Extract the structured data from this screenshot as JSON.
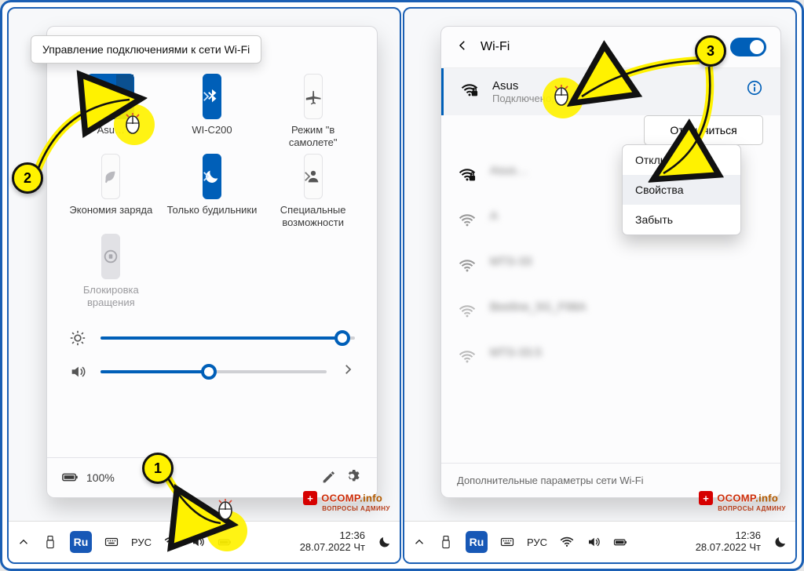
{
  "tooltip": "Управление подключениями к сети Wi-Fi",
  "tiles": {
    "wifi": "Asu…",
    "bt": "WI-C200",
    "airplane": "Режим \"в самолете\"",
    "battery_saver": "Экономия заряда",
    "focus": "Только будильники",
    "access": "Специальные возможности",
    "lock_rot": "Блокировка вращения"
  },
  "battery_pct": "100%",
  "taskbar": {
    "lang": "РУС",
    "ru": "Ru",
    "time": "12:36",
    "date": "28.07.2022 Чт"
  },
  "wifi": {
    "title": "Wi-Fi",
    "active": {
      "name": "Asus",
      "status": "Подключено, защищено"
    },
    "disconnect_btn": "Отключиться",
    "ctx": {
      "disconnect": "Отключить",
      "props": "Свойства",
      "forget": "Забыть"
    },
    "others": [
      "Asus…",
      "A",
      "MTS-33",
      "Beeline_5G_F98A",
      "MTS-33.5"
    ],
    "footer": "Дополнительные параметры сети Wi-Fi"
  },
  "steps": {
    "s1": "1",
    "s2": "2",
    "s3": "3"
  },
  "watermark": {
    "a": "OCOMP",
    "b": ".info",
    "sub": "ВОПРОСЫ АДМИНУ"
  }
}
